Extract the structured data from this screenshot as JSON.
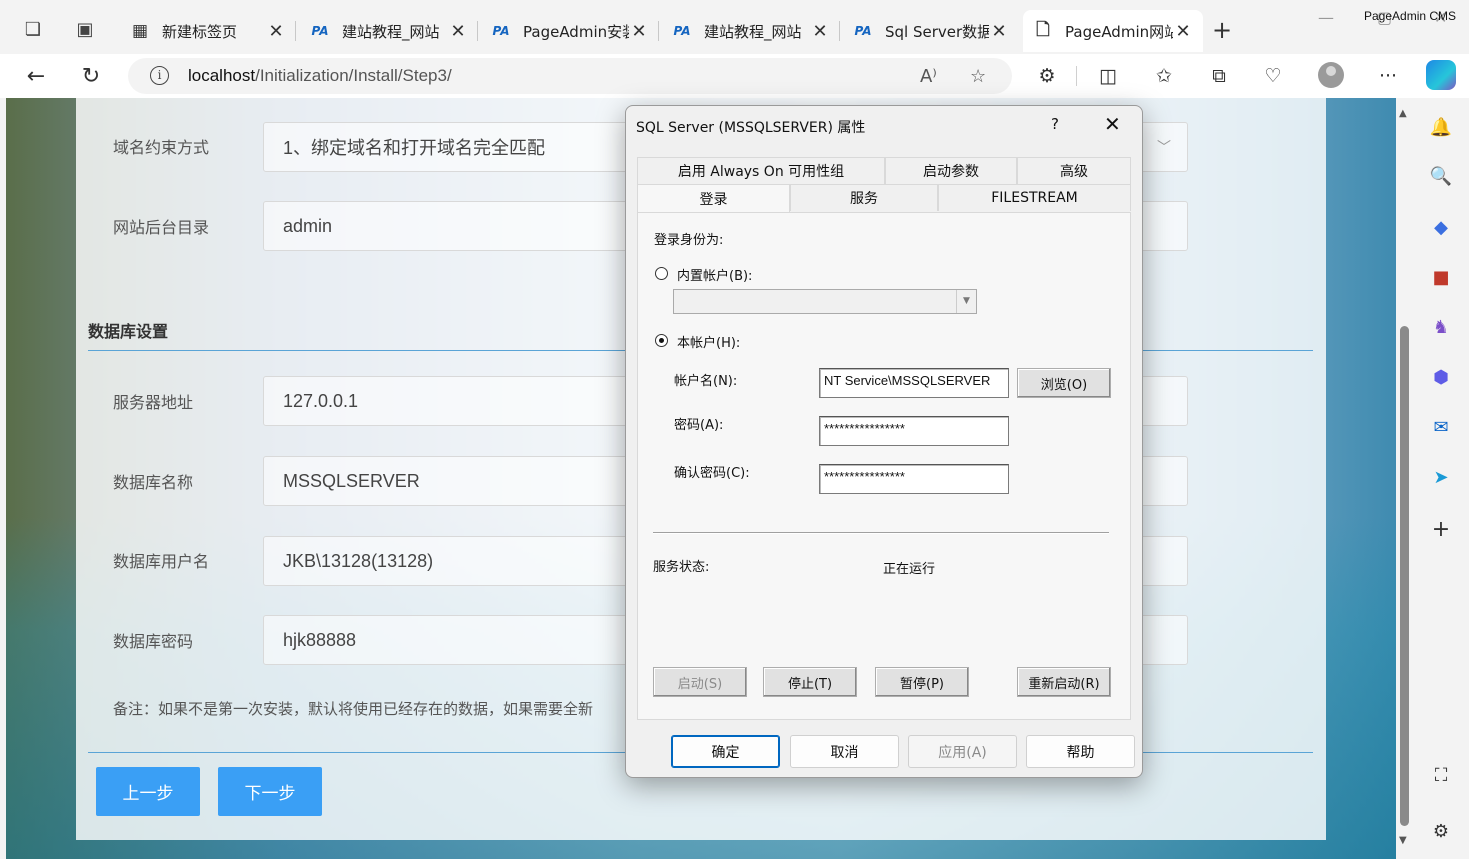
{
  "window": {
    "title_label": "PageAdmin CMS"
  },
  "tabs": [
    {
      "title": "新建标签页",
      "icon": "new-tab-page-icon"
    },
    {
      "title": "建站教程_网站",
      "icon": "pageadmin-logo-icon"
    },
    {
      "title": "PageAdmin安装",
      "icon": "pageadmin-logo-icon"
    },
    {
      "title": "建站教程_网站",
      "icon": "pageadmin-logo-icon"
    },
    {
      "title": "Sql Server数据",
      "icon": "pageadmin-logo-icon"
    },
    {
      "title": "PageAdmin网站",
      "icon": "page-icon",
      "active": true
    }
  ],
  "tab_favicon_text": "PA",
  "address": {
    "host": "localhost",
    "path": "/Initialization/Install/Step3/"
  },
  "page": {
    "fields_top": [
      {
        "label": "域名约束方式",
        "value": "1、绑定域名和打开域名完全匹配",
        "has_dropdown": true
      },
      {
        "label": "网站后台目录",
        "value": "admin"
      }
    ],
    "db_section_title": "数据库设置",
    "db_fields": [
      {
        "label": "服务器地址",
        "value": "127.0.0.1"
      },
      {
        "label": "数据库名称",
        "value": "MSSQLSERVER"
      },
      {
        "label": "数据库用户名",
        "value": "JKB\\13128(13128)"
      },
      {
        "label": "数据库密码",
        "value": "hjk88888"
      }
    ],
    "note": "备注：如果不是第一次安装，默认将使用已经存在的数据，如果需要全新",
    "prev_button": "上一步",
    "next_button": "下一步"
  },
  "dialog": {
    "title": "SQL Server (MSSQLSERVER) 属性",
    "help": "?",
    "tabs_row1": [
      "启用 Always On 可用性组",
      "启动参数",
      "高级"
    ],
    "tabs_row2": [
      "登录",
      "服务",
      "FILESTREAM"
    ],
    "selected_tab": "登录",
    "login_as": "登录身份为:",
    "builtin_account": "内置帐户(B):",
    "builtin_selected": false,
    "this_account": "本帐户(H):",
    "this_account_selected": true,
    "account_name_label": "帐户名(N):",
    "account_name_value": "NT Service\\MSSQLSERVER",
    "browse_button": "浏览(O)",
    "password_label": "密码(A):",
    "password_value": "****************",
    "confirm_label": "确认密码(C):",
    "confirm_value": "****************",
    "service_status_label": "服务状态:",
    "service_status_value": "正在运行",
    "service_buttons": [
      {
        "label": "启动(S)",
        "enabled": false
      },
      {
        "label": "停止(T)",
        "enabled": true
      },
      {
        "label": "暂停(P)",
        "enabled": true
      },
      {
        "label": "重新启动(R)",
        "enabled": true
      }
    ],
    "footer_buttons": [
      {
        "label": "确定",
        "primary": true,
        "enabled": true
      },
      {
        "label": "取消",
        "enabled": true
      },
      {
        "label": "应用(A)",
        "enabled": false
      },
      {
        "label": "帮助",
        "enabled": true
      }
    ]
  },
  "colors": {
    "accent_button": "#3a9ff5",
    "divider": "#5aa4d6",
    "focus": "#0067c0"
  }
}
